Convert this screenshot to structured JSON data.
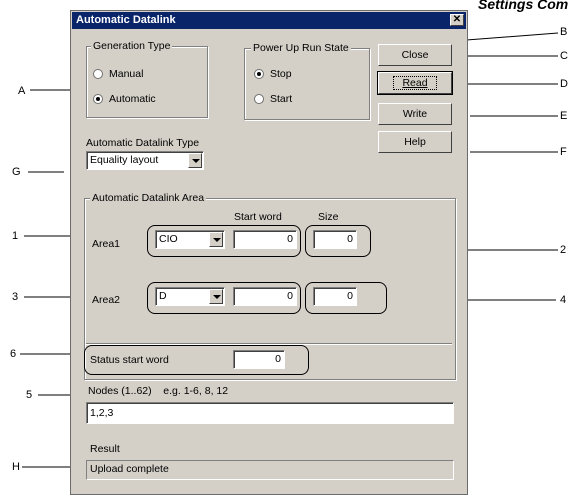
{
  "header_text": "Settings Com",
  "dialog": {
    "title": "Automatic Datalink",
    "close_glyph": "✕"
  },
  "generation_type": {
    "legend": "Generation Type",
    "options": [
      "Manual",
      "Automatic"
    ],
    "selected": "Automatic"
  },
  "power_up": {
    "legend": "Power Up Run State",
    "options": [
      "Stop",
      "Start"
    ],
    "selected": "Stop"
  },
  "buttons": {
    "close": "Close",
    "read": "Read",
    "write": "Write",
    "help": "Help"
  },
  "datalink_type": {
    "label": "Automatic Datalink Type",
    "value": "Equality layout"
  },
  "area_group": {
    "legend": "Automatic Datalink Area",
    "start_word_header": "Start word",
    "size_header": "Size",
    "area1": {
      "label": "Area1",
      "memory": "CIO",
      "start": "0",
      "size": "0"
    },
    "area2": {
      "label": "Area2",
      "memory": "D",
      "start": "0",
      "size": "0"
    }
  },
  "status": {
    "label": "Status start word",
    "value": "0"
  },
  "nodes": {
    "label": "Nodes (1..62)    e.g. 1-6, 8, 12",
    "value": "1,2,3"
  },
  "result": {
    "label": "Result",
    "value": "Upload complete"
  },
  "callouts": [
    "A",
    "B",
    "C",
    "D",
    "E",
    "F",
    "G",
    "H",
    "1",
    "2",
    "3",
    "4",
    "5",
    "6"
  ]
}
